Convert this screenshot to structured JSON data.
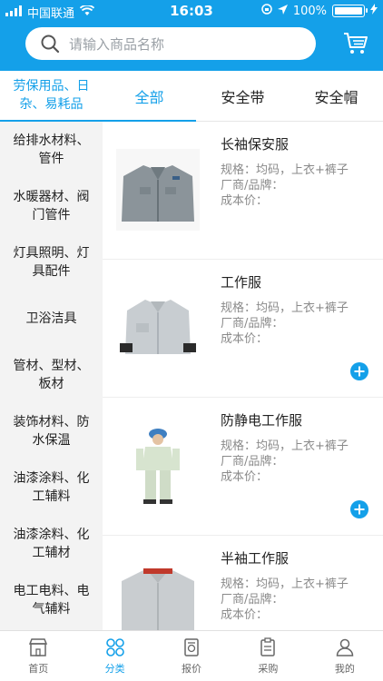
{
  "status_bar": {
    "carrier": "中国联通",
    "time": "16:03",
    "battery": "100%",
    "battery_level": 1.0
  },
  "search": {
    "placeholder": "请输入商品名称"
  },
  "category_header": "劳保用品、日杂、易耗品",
  "tabs": [
    {
      "label": "全部",
      "active": true
    },
    {
      "label": "安全带",
      "active": false
    },
    {
      "label": "安全帽",
      "active": false
    }
  ],
  "sidebar": {
    "items": [
      "给排水材料、管件",
      "水暖器材、阀门管件",
      "灯具照明、灯具配件",
      "卫浴洁具",
      "管材、型材、板材",
      "装饰材料、防水保温",
      "油漆涂料、化工辅料",
      "油漆涂料、化工辅材",
      "电工电料、电气辅料"
    ]
  },
  "products": [
    {
      "name": "长袖保安服",
      "spec": "规格：均码，上衣+裤子",
      "brand": "厂商/品牌：",
      "cost": "成本价：",
      "icon": "uniform-gray",
      "show_add": false
    },
    {
      "name": "工作服",
      "spec": "规格：均码，上衣+裤子",
      "brand": "厂商/品牌：",
      "cost": "成本价：",
      "icon": "work-jacket",
      "show_add": true
    },
    {
      "name": "防静电工作服",
      "spec": "规格：均码，上衣+裤子",
      "brand": "厂商/品牌：",
      "cost": "成本价：",
      "icon": "antistatic-suit",
      "show_add": true
    },
    {
      "name": "半袖工作服",
      "spec": "规格：均码，上衣+裤子",
      "brand": "厂商/品牌：",
      "cost": "成本价：",
      "icon": "short-sleeve-set",
      "show_add": false
    }
  ],
  "bottom_nav": [
    {
      "label": "首页",
      "icon": "shop-icon",
      "active": false
    },
    {
      "label": "分类",
      "icon": "category-icon",
      "active": true
    },
    {
      "label": "报价",
      "icon": "quote-icon",
      "active": false
    },
    {
      "label": "采购",
      "icon": "purchase-icon",
      "active": false
    },
    {
      "label": "我的",
      "icon": "user-icon",
      "active": false
    }
  ],
  "colors": {
    "brand": "#14a0e9",
    "sidebar_bg": "#f3f3f3"
  }
}
